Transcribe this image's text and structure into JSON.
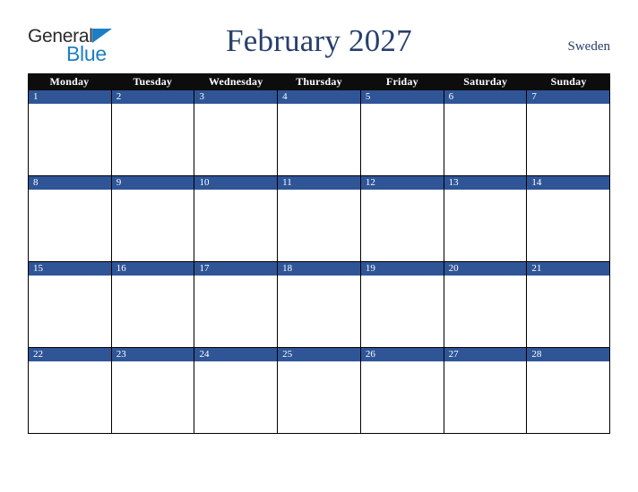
{
  "header": {
    "logo": {
      "word1": "General",
      "word2": "Blue",
      "triangle_icon": "blue-triangle-icon",
      "color_dark": "#2b2b2b",
      "color_blue": "#1b7fc4"
    },
    "title": "February 2027",
    "country": "Sweden",
    "title_color": "#27406b"
  },
  "calendar": {
    "month": "February",
    "year": "2027",
    "weekday_headers": [
      "Monday",
      "Tuesday",
      "Wednesday",
      "Thursday",
      "Friday",
      "Saturday",
      "Sunday"
    ],
    "header_bg": "#0d0d0d",
    "header_text_color": "#ffffff",
    "day_band_color": "#2f5597",
    "day_number_color": "#ffffff",
    "cell_bg": "#ffffff",
    "border_color": "#000000",
    "weeks": [
      {
        "days": [
          {
            "number": "1",
            "empty": false
          },
          {
            "number": "2",
            "empty": false
          },
          {
            "number": "3",
            "empty": false
          },
          {
            "number": "4",
            "empty": false
          },
          {
            "number": "5",
            "empty": false
          },
          {
            "number": "6",
            "empty": false
          },
          {
            "number": "7",
            "empty": false
          }
        ]
      },
      {
        "days": [
          {
            "number": "8",
            "empty": false
          },
          {
            "number": "9",
            "empty": false
          },
          {
            "number": "10",
            "empty": false
          },
          {
            "number": "11",
            "empty": false
          },
          {
            "number": "12",
            "empty": false
          },
          {
            "number": "13",
            "empty": false
          },
          {
            "number": "14",
            "empty": false
          }
        ]
      },
      {
        "days": [
          {
            "number": "15",
            "empty": false
          },
          {
            "number": "16",
            "empty": false
          },
          {
            "number": "17",
            "empty": false
          },
          {
            "number": "18",
            "empty": false
          },
          {
            "number": "19",
            "empty": false
          },
          {
            "number": "20",
            "empty": false
          },
          {
            "number": "21",
            "empty": false
          }
        ]
      },
      {
        "days": [
          {
            "number": "22",
            "empty": false
          },
          {
            "number": "23",
            "empty": false
          },
          {
            "number": "24",
            "empty": false
          },
          {
            "number": "25",
            "empty": false
          },
          {
            "number": "26",
            "empty": false
          },
          {
            "number": "27",
            "empty": false
          },
          {
            "number": "28",
            "empty": false
          }
        ]
      }
    ]
  }
}
